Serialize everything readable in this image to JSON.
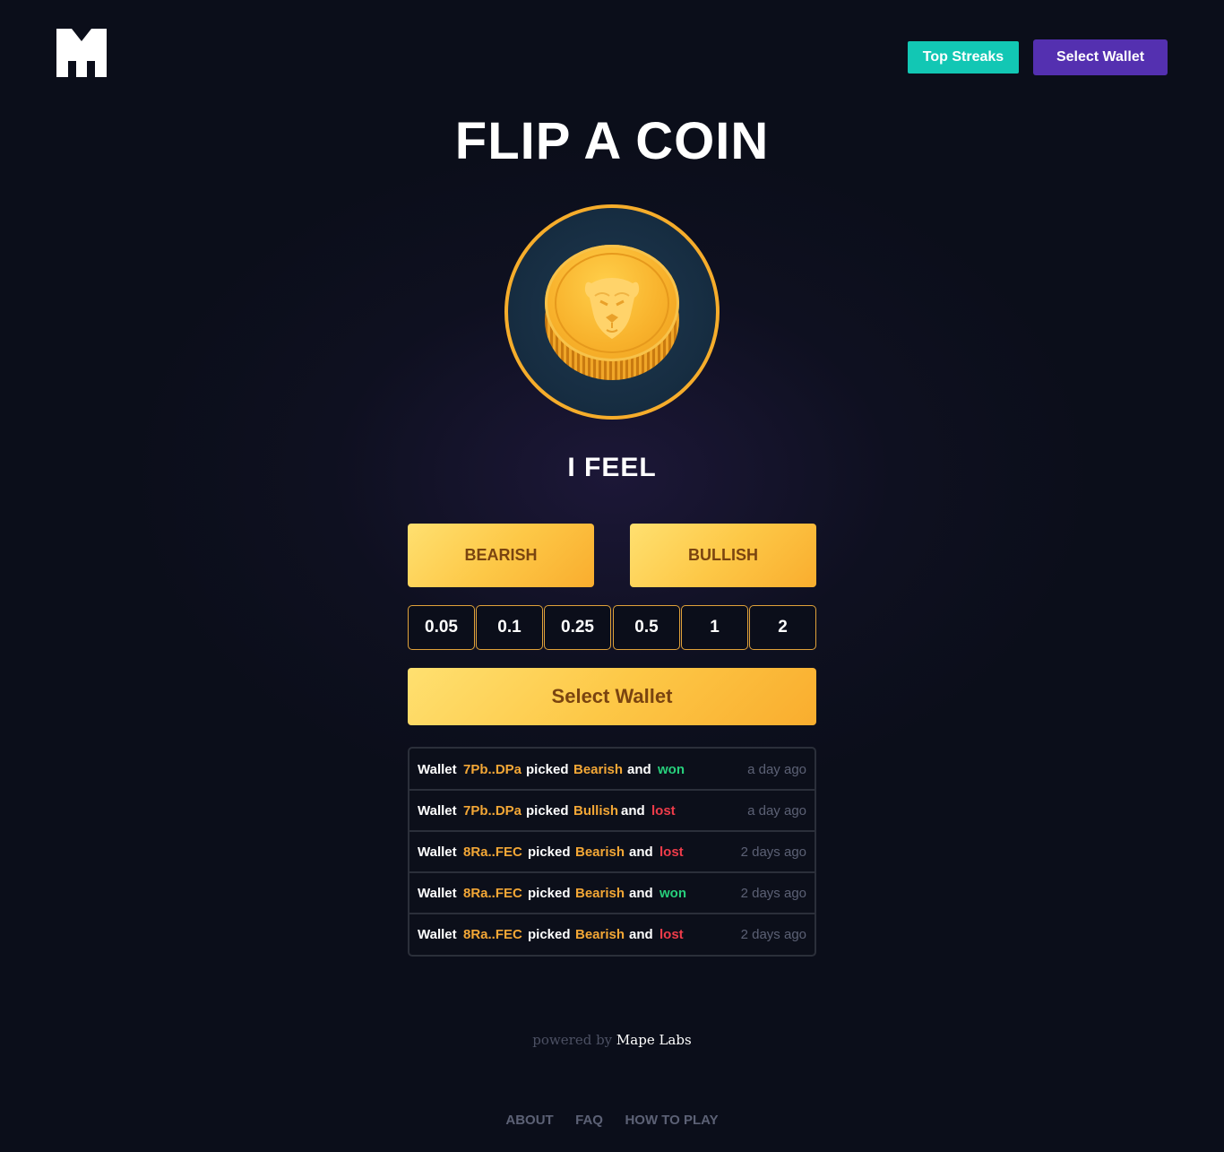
{
  "header": {
    "logo": "M",
    "top_streaks_label": "Top Streaks",
    "select_wallet_label": "Select Wallet"
  },
  "main": {
    "title": "FLIP A COIN",
    "coin_icon": "bull-head-icon",
    "feel_label": "I FEEL",
    "bearish_label": "BEARISH",
    "bullish_label": "BULLISH",
    "amounts": [
      "0.05",
      "0.1",
      "0.25",
      "0.5",
      "1",
      "2"
    ],
    "select_wallet_label": "Select Wallet"
  },
  "history": [
    {
      "prefix": "Wallet",
      "address": "7Pb..DPa",
      "verb": "picked",
      "side": "Bearish",
      "conj": "and",
      "result": "won",
      "time": "a day ago"
    },
    {
      "prefix": "Wallet",
      "address": "7Pb..DPa",
      "verb": "picked",
      "side": "Bullish",
      "conj": "and",
      "result": "lost",
      "time": "a day ago"
    },
    {
      "prefix": "Wallet",
      "address": "8Ra..FEC",
      "verb": "picked",
      "side": "Bearish",
      "conj": "and",
      "result": "lost",
      "time": "2 days ago"
    },
    {
      "prefix": "Wallet",
      "address": "8Ra..FEC",
      "verb": "picked",
      "side": "Bearish",
      "conj": "and",
      "result": "won",
      "time": "2 days ago"
    },
    {
      "prefix": "Wallet",
      "address": "8Ra..FEC",
      "verb": "picked",
      "side": "Bearish",
      "conj": "and",
      "result": "lost",
      "time": "2 days ago"
    }
  ],
  "footer": {
    "powered_prefix": "powered by",
    "powered_brand": "Mape Labs",
    "links": [
      "ABOUT",
      "FAQ",
      "HOW TO PLAY"
    ]
  },
  "colors": {
    "background": "#0b0e1a",
    "accent_gold": "#fdc847",
    "teal": "#12c7b4",
    "purple": "#5430b0",
    "won": "#27d07c",
    "lost": "#ef3c4a"
  }
}
